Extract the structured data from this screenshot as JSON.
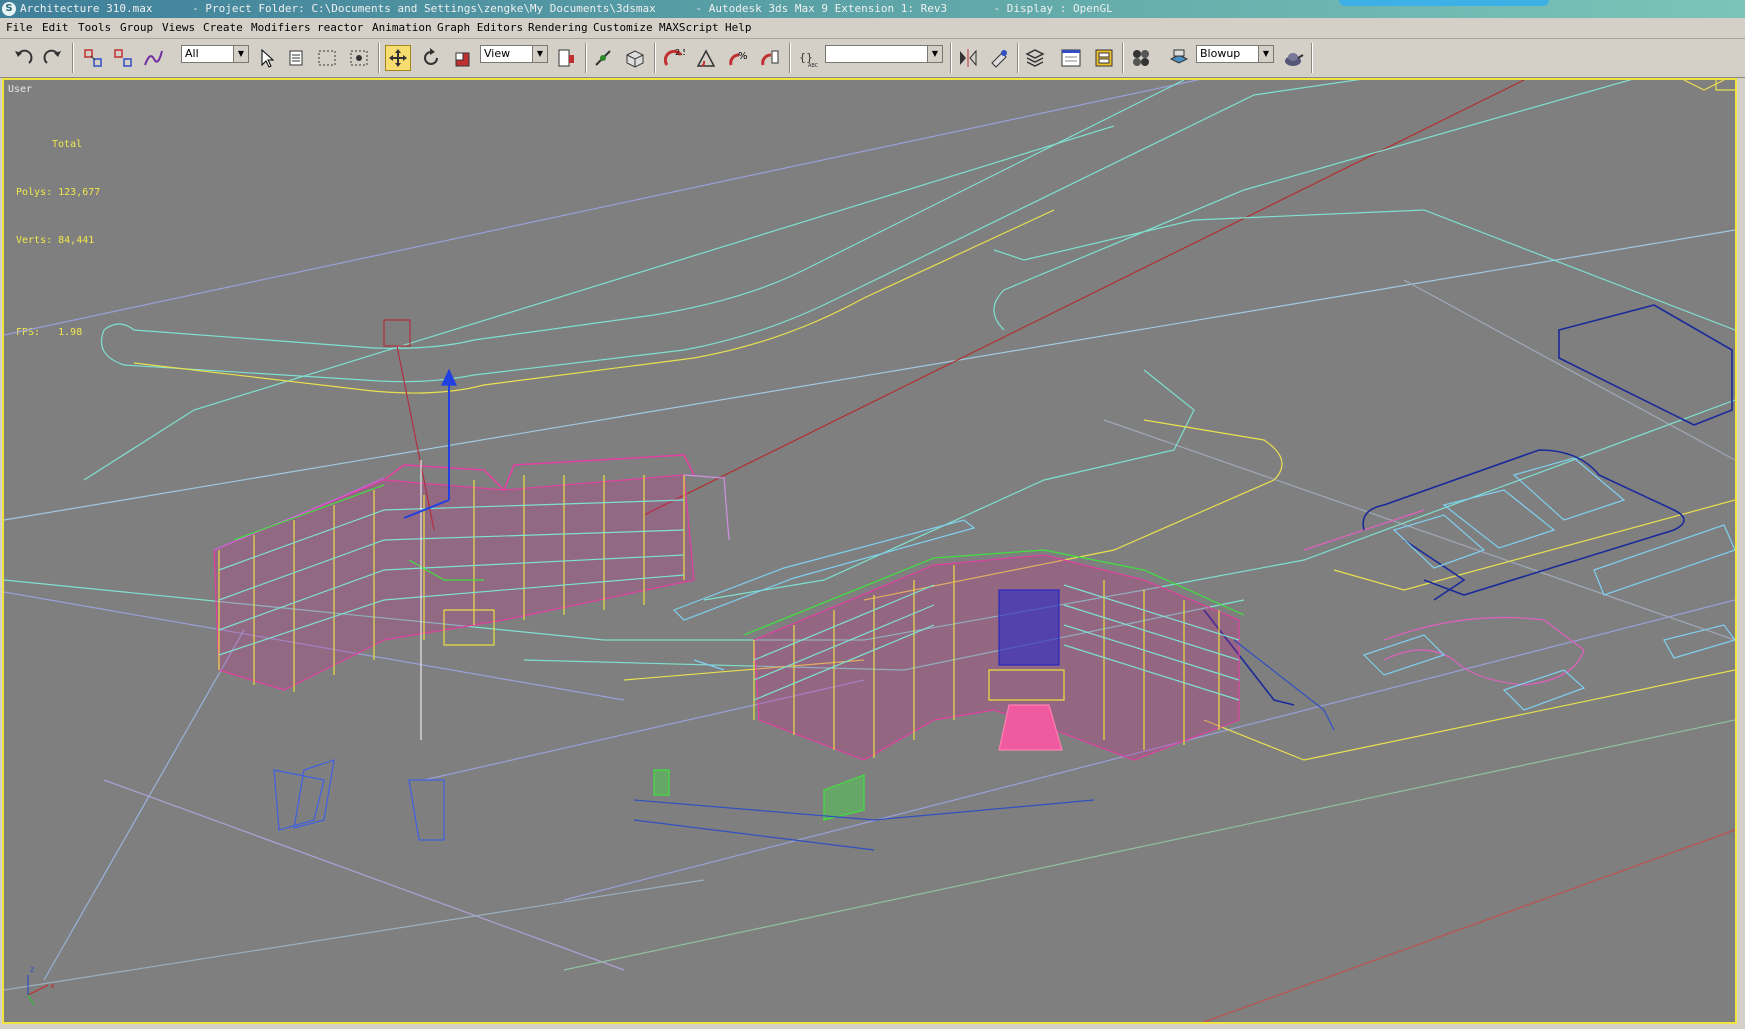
{
  "window": {
    "title": "Architecture 310.max      - Project Folder: C:\\Documents and Settings\\zengke\\My Documents\\3dsmax      - Autodesk 3ds Max 9 Extension 1: Rev3       - Display : OpenGL"
  },
  "menu": [
    {
      "label": "File"
    },
    {
      "label": "Edit"
    },
    {
      "label": "Tools"
    },
    {
      "label": "Group"
    },
    {
      "label": "Views"
    },
    {
      "label": "Create"
    },
    {
      "label": "Modifiers"
    },
    {
      "label": "reactor"
    },
    {
      "label": "Animation"
    },
    {
      "label": "Graph Editors"
    },
    {
      "label": "Rendering"
    },
    {
      "label": "Customize"
    },
    {
      "label": "MAXScript"
    },
    {
      "label": "Help"
    }
  ],
  "toolbar": {
    "selection_filter": "All",
    "reference_coord": "View",
    "named_selection": "",
    "render_type": "Blowup",
    "snap_label": "2.5"
  },
  "viewport": {
    "label": "User",
    "stats_header": "Total",
    "polys": "Polys: 123,677",
    "verts": "Verts: 84,441",
    "fps": "FPS:   1.98"
  },
  "colors": {
    "viewport_bg": "#7f7f7f",
    "active_border": "#f0e442",
    "stats_text": "#f0e84a",
    "wire_cyan": "#7fe0d0",
    "wire_magenta": "#e040a0",
    "wire_blue": "#1a2a9a"
  }
}
